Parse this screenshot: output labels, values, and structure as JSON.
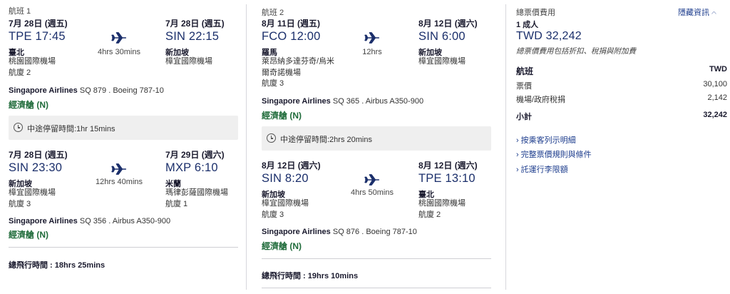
{
  "leg1": {
    "title": "航班 1",
    "seg1": {
      "dep_date": "7月 28日 (週五)",
      "arr_date": "7月 28日 (週五)",
      "dep_time": "TPE 17:45",
      "arr_time": "SIN 22:15",
      "duration": "4hrs 30mins",
      "dep_city": "臺北",
      "dep_airport": "桃園國際機場",
      "dep_terminal": "航廈 2",
      "arr_city": "新加坡",
      "arr_airport": "樟宜國際機場",
      "airline_name": "Singapore Airlines",
      "flight": "SQ 879 . Boeing 787-10",
      "cabin": "經濟艙 (N)"
    },
    "layover": "中途停留時間:1hr 15mins",
    "seg2": {
      "dep_date": "7月 28日 (週五)",
      "arr_date": "7月 29日 (週六)",
      "dep_time": "SIN 23:30",
      "arr_time": "MXP 6:10",
      "duration": "12hrs 40mins",
      "dep_city": "新加坡",
      "dep_airport": "樟宜國際機場",
      "dep_terminal": "航廈 3",
      "arr_city": "米蘭",
      "arr_airport": "瑪律彭薩國際機場",
      "arr_terminal": "航廈 1",
      "airline_name": "Singapore Airlines",
      "flight": "SQ 356 . Airbus A350-900",
      "cabin": "經濟艙 (N)"
    },
    "total": "總飛行時間 : 18hrs 25mins"
  },
  "leg2": {
    "title": "航班 2",
    "seg1": {
      "dep_date": "8月 11日 (週五)",
      "arr_date": "8月 12日 (週六)",
      "dep_time": "FCO 12:00",
      "arr_time": "SIN 6:00",
      "duration": "12hrs",
      "dep_city": "羅馬",
      "dep_airport1": "萊昂納多達芬奇/烏米",
      "dep_airport2": "爾奇諾機場",
      "dep_terminal": "航廈 3",
      "arr_city": "新加坡",
      "arr_airport": "樟宜國際機場",
      "airline_name": "Singapore Airlines",
      "flight": "SQ 365 . Airbus A350-900",
      "cabin": "經濟艙 (N)"
    },
    "layover": "中途停留時間:2hrs 20mins",
    "seg2": {
      "dep_date": "8月 12日 (週六)",
      "arr_date": "8月 12日 (週六)",
      "dep_time": "SIN 8:20",
      "arr_time": "TPE 13:10",
      "duration": "4hrs 50mins",
      "dep_city": "新加坡",
      "dep_airport": "樟宜國際機場",
      "dep_terminal": "航廈 3",
      "arr_city": "臺北",
      "arr_airport": "桃園國際機場",
      "arr_terminal": "航廈 2",
      "airline_name": "Singapore Airlines",
      "flight": "SQ 876 . Boeing 787-10",
      "cabin": "經濟艙 (N)"
    },
    "total": "總飛行時間 : 19hrs 10mins"
  },
  "summary": {
    "heading": "總票價費用",
    "hide_link": "隱藏資訊",
    "passengers": "1 成人",
    "price": "TWD 32,242",
    "note": "總票價費用包括折扣、稅捐與附加費",
    "flight_label": "航班",
    "currency": "TWD",
    "fare_label": "票價",
    "fare_value": "30,100",
    "tax_label": "機場/政府稅捐",
    "tax_value": "2,142",
    "subtotal_label": "小計",
    "subtotal_value": "32,242",
    "links": [
      "按乘客列示明細",
      "完整票價規則與條件",
      "託運行李限額"
    ]
  },
  "colors": {
    "time": "#1b2f6b",
    "cabin": "#1f6b3a",
    "link": "#1b3b8c"
  }
}
